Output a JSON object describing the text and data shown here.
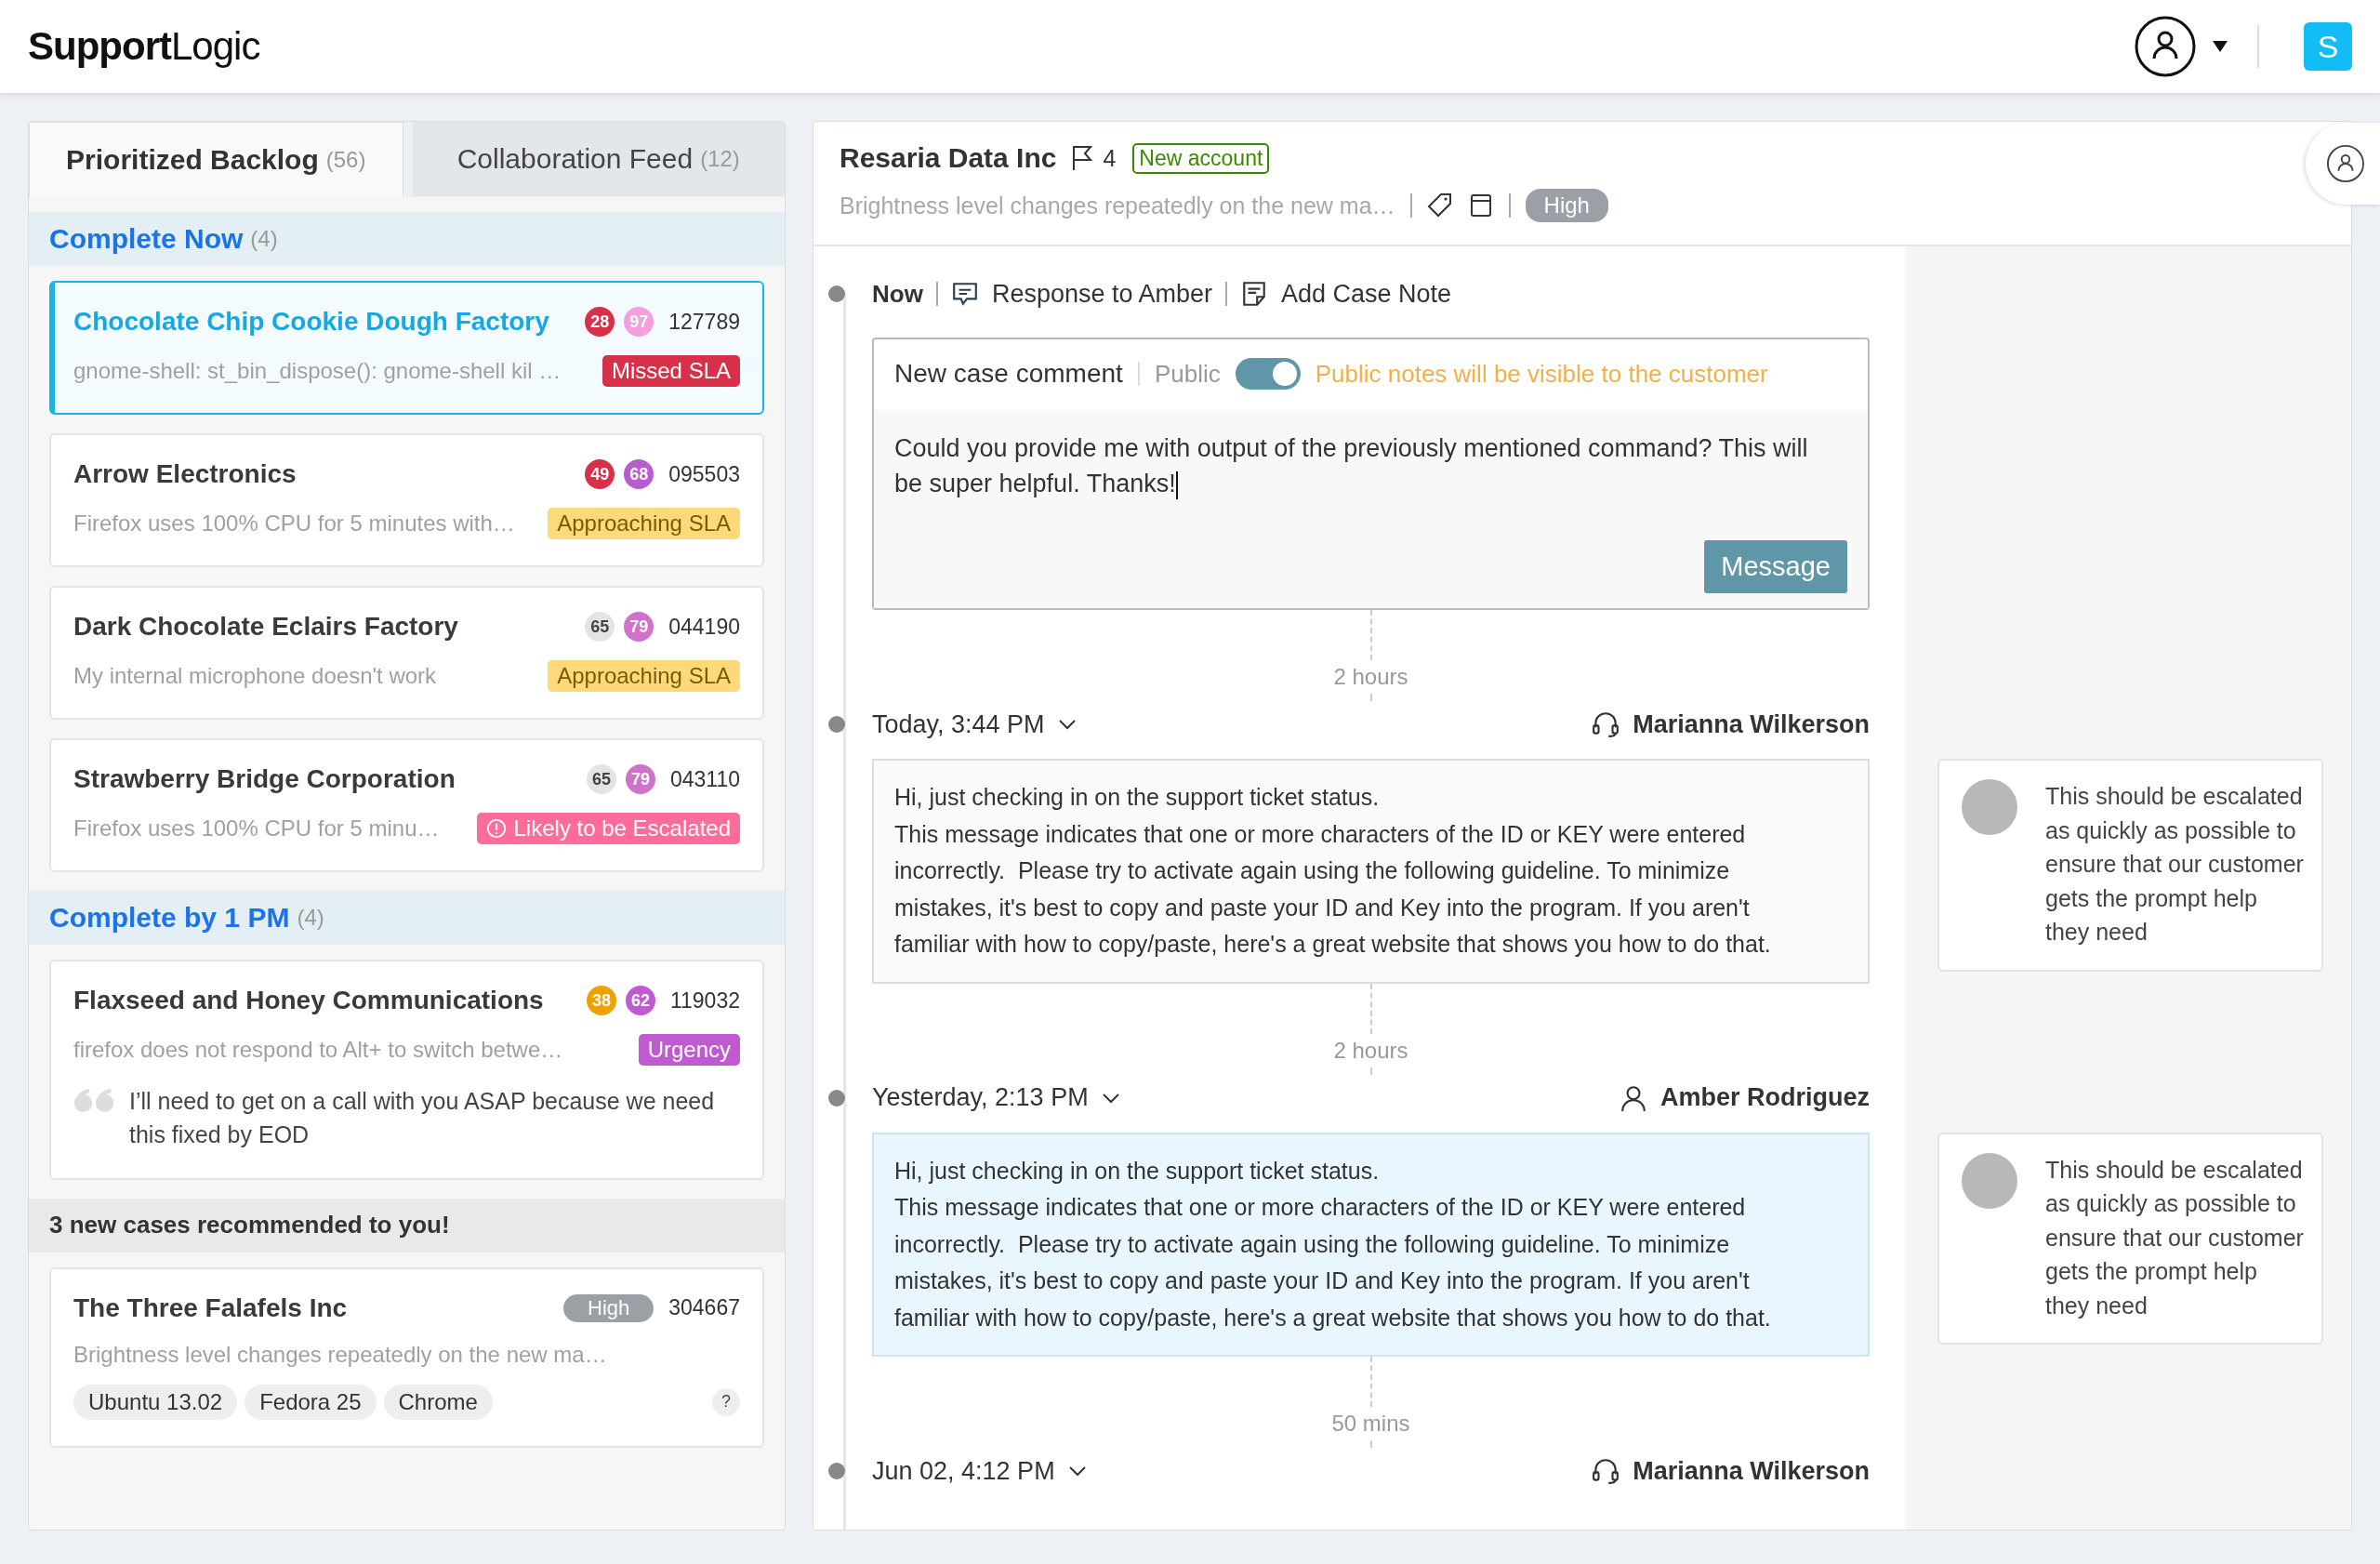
{
  "brand": {
    "strong": "Support",
    "light": "Logic"
  },
  "account": {
    "initial": "S"
  },
  "tabs": [
    {
      "label": "Prioritized Backlog",
      "count": "(56)",
      "selected": true
    },
    {
      "label": "Collaboration Feed",
      "count": "(12)",
      "selected": false
    }
  ],
  "sections": [
    {
      "kind": "group",
      "title": "Complete Now",
      "count": "(4)",
      "cases": [
        {
          "title": "Chocolate Chip Cookie Dough Factory",
          "selected": true,
          "scores": [
            {
              "value": "28",
              "color": "#d9304a"
            },
            {
              "value": "97",
              "color": "#f59ee0"
            }
          ],
          "number": "127789",
          "summary": "gnome-shell: st_bin_dispose(): gnome-shell kil …",
          "tag": {
            "kind": "missed",
            "label": "Missed SLA"
          }
        },
        {
          "title": "Arrow Electronics",
          "selected": false,
          "scores": [
            {
              "value": "49",
              "color": "#d9304a"
            },
            {
              "value": "68",
              "color": "#b85cd0"
            }
          ],
          "number": "095503",
          "summary": "Firefox uses 100% CPU for 5 minutes with…",
          "tag": {
            "kind": "approaching",
            "label": "Approaching SLA"
          }
        },
        {
          "title": "Dark Chocolate Eclairs Factory",
          "selected": false,
          "scores": [
            {
              "value": "65",
              "color": "#e4e4e4"
            },
            {
              "value": "79",
              "color": "#d072cc"
            }
          ],
          "number": "044190",
          "summary": "My internal microphone doesn't work",
          "tag": {
            "kind": "approaching",
            "label": "Approaching SLA"
          }
        },
        {
          "title": "Strawberry Bridge Corporation",
          "selected": false,
          "scores": [
            {
              "value": "65",
              "color": "#e4e4e4"
            },
            {
              "value": "79",
              "color": "#d072cc"
            }
          ],
          "number": "043110",
          "summary": "Firefox uses 100% CPU for 5 minu…",
          "tag": {
            "kind": "escalated",
            "label": "Likely to be Escalated"
          }
        }
      ]
    },
    {
      "kind": "group",
      "title": "Complete by 1 PM",
      "count": "(4)",
      "cases": [
        {
          "title": "Flaxseed and Honey Communications",
          "selected": false,
          "scores": [
            {
              "value": "38",
              "color": "#f0a000"
            },
            {
              "value": "62",
              "color": "#c05ad0"
            }
          ],
          "number": "119032",
          "summary": "firefox does not respond to Alt+ to switch betwe…",
          "tag": {
            "kind": "urgency",
            "label": "Urgency"
          },
          "quote": "I’ll need to get on a call with you ASAP because we need this fixed by EOD"
        }
      ]
    },
    {
      "kind": "recommended",
      "title": "3 new cases recommended to you!",
      "cases": [
        {
          "title": "The Three Falafels Inc",
          "selected": false,
          "priority": "High",
          "number": "304667",
          "summary": "Brightness level changes repeatedly on the new ma…",
          "chips": [
            "Ubuntu 13.02",
            "Fedora 25",
            "Chrome"
          ],
          "help": "?"
        }
      ]
    }
  ],
  "case": {
    "title": "Resaria Data Inc",
    "flag_count": "4",
    "badge": "New account",
    "summary": "Brightness level changes repeatedly on the new ma…",
    "priority": "High"
  },
  "composer": {
    "now": "Now",
    "actions": [
      {
        "kind": "response",
        "label": "Response to Amber"
      },
      {
        "kind": "note",
        "label": "Add Case Note"
      }
    ],
    "title": "New case comment",
    "visibility": "Public",
    "public": true,
    "notice": "Public notes will be visible to the customer",
    "text": "Could you provide me with output of the previously mentioned command? This will be super helpful. Thanks!",
    "button": "Message"
  },
  "timeline": [
    {
      "gap": "2 hours",
      "time": "Today, 3:44 PM",
      "author": "Marianna Wilkerson",
      "kind": "agent",
      "highlight": false,
      "body": [
        "Hi, just checking in on the support ticket status.",
        "This message indicates that one or more characters of the ID or KEY were entered incorrectly.  Please try to activate again using the following guideline. To minimize mistakes, it's best to copy and paste your ID and Key into the program. If you aren't familiar with how to copy/paste, here's a great website that shows you how to do that."
      ],
      "note": "This should be escalated as quickly as possible to ensure that our customer gets the prompt help they need"
    },
    {
      "gap": "2 hours",
      "time": "Yesterday, 2:13 PM",
      "author": "Amber Rodriguez",
      "kind": "customer",
      "highlight": true,
      "body": [
        "Hi, just checking in on the support ticket status.",
        "This message indicates that one or more characters of the ID or KEY were entered incorrectly.  Please try to activate again using the following guideline. To minimize mistakes, it's best to copy and paste your ID and Key into the program. If you aren't familiar with how to copy/paste, here's a great website that shows you how to do that."
      ],
      "note": "This should be escalated as quickly as possible to ensure that our customer gets the prompt help they need"
    },
    {
      "gap": "50 mins",
      "time": "Jun 02, 4:12 PM",
      "author": "Marianna Wilkerson",
      "kind": "agent"
    }
  ]
}
